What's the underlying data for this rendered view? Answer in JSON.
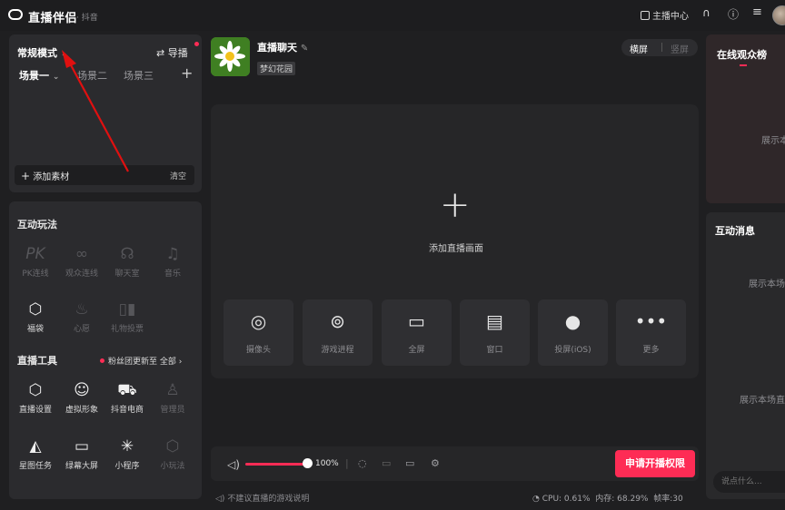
{
  "app": {
    "name": "直播伴侣",
    "platform": "· 抖音"
  },
  "topbar": {
    "anchor_center": "主播中心"
  },
  "scene_panel": {
    "mode_label": "常规模式",
    "guide_label": "导播",
    "scenes": [
      "场景一",
      "场景二",
      "场景三"
    ],
    "add_material": "添加素材",
    "clear": "清空"
  },
  "interactive": {
    "title": "互动玩法",
    "items": [
      {
        "label": "PK连线",
        "icon": "pk-icon",
        "enabled": false
      },
      {
        "label": "观众连线",
        "icon": "link-icon",
        "enabled": false
      },
      {
        "label": "聊天室",
        "icon": "chat-room-icon",
        "enabled": false
      },
      {
        "label": "音乐",
        "icon": "music-icon",
        "enabled": false
      },
      {
        "label": "福袋",
        "icon": "lucky-bag-icon",
        "enabled": true
      },
      {
        "label": "心愿",
        "icon": "wish-icon",
        "enabled": false
      },
      {
        "label": "礼物投票",
        "icon": "gift-vote-icon",
        "enabled": false
      }
    ]
  },
  "live_tools": {
    "title": "直播工具",
    "fan_note": "粉丝团更新至",
    "all_label": "全部",
    "items": [
      {
        "label": "直播设置",
        "icon": "settings-hex-icon",
        "enabled": true
      },
      {
        "label": "虚拟形象",
        "icon": "avatar-icon",
        "enabled": true
      },
      {
        "label": "抖音电商",
        "icon": "cart-icon",
        "enabled": true
      },
      {
        "label": "管理员",
        "icon": "admin-icon",
        "enabled": false
      },
      {
        "label": "星图任务",
        "icon": "star-map-icon",
        "enabled": true
      },
      {
        "label": "绿幕大屏",
        "icon": "monitor-icon",
        "enabled": true
      },
      {
        "label": "小程序",
        "icon": "mini-program-icon",
        "enabled": true
      },
      {
        "label": "小玩法",
        "icon": "mini-game-icon",
        "enabled": false
      }
    ]
  },
  "room": {
    "title": "直播聊天",
    "tag": "梦幻花园"
  },
  "orientation": {
    "horizontal": "横屏",
    "vertical": "竖屏"
  },
  "canvas": {
    "add_label": "添加直播画面",
    "sources": [
      {
        "label": "摄像头",
        "icon": "camera-icon"
      },
      {
        "label": "游戏进程",
        "icon": "gamepad-icon"
      },
      {
        "label": "全屏",
        "icon": "fullscreen-monitor-icon"
      },
      {
        "label": "窗口",
        "icon": "window-icon"
      },
      {
        "label": "投屏(iOS)",
        "icon": "apple-icon"
      },
      {
        "label": "更多",
        "icon": "more-icon"
      }
    ]
  },
  "controls": {
    "volume_percent": 100,
    "volume_label": "100%",
    "apply_button": "申请开播权限"
  },
  "status": {
    "note": "不建议直播的游戏说明",
    "cpu": "CPU: 0.61%",
    "memory": "内存: 68.29%",
    "fps": "帧率:30"
  },
  "audience_panel": {
    "title": "在线观众榜",
    "empty": "展示本"
  },
  "messages_panel": {
    "title": "互动消息",
    "empty1": "展示本场",
    "empty2": "展示本场直",
    "placeholder": "说点什么..."
  },
  "colors": {
    "accent": "#fe2c55",
    "annotation_arrow": "#e01010",
    "background": "#1f1f21"
  }
}
